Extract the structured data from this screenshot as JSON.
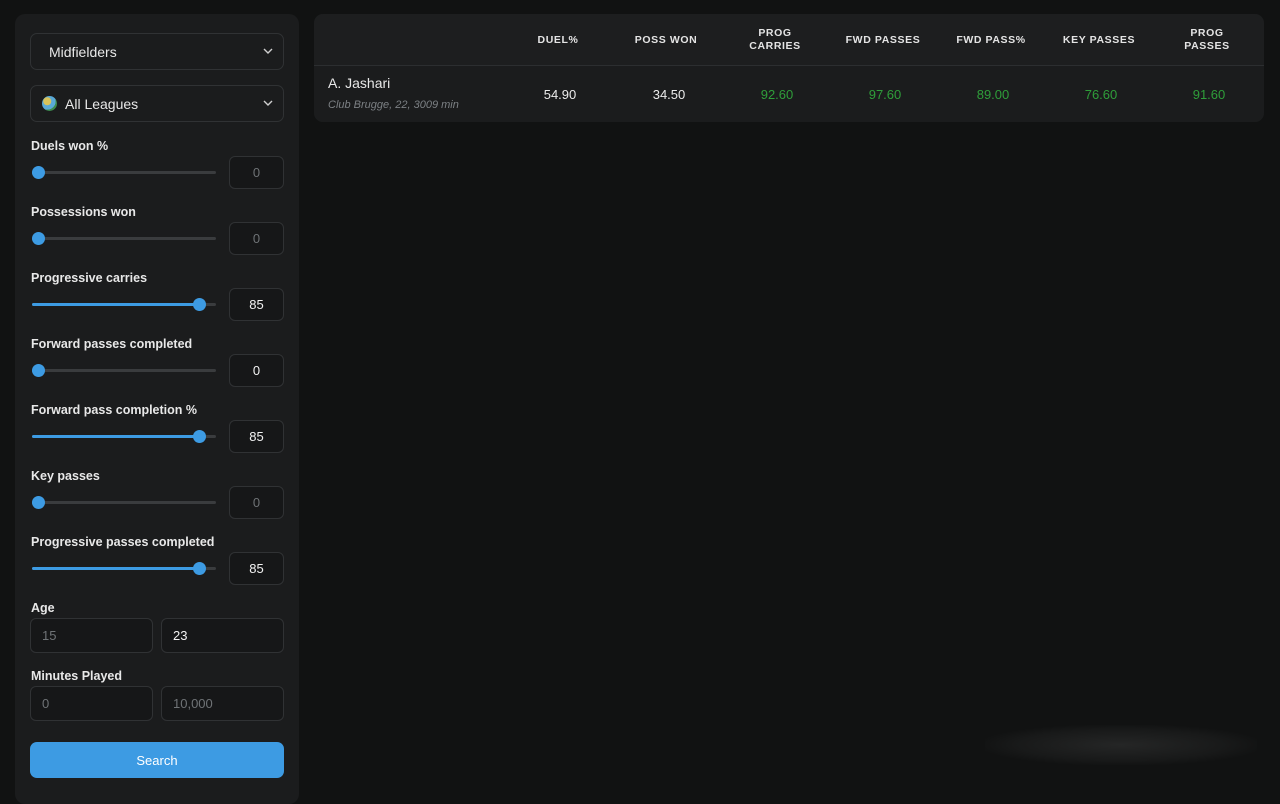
{
  "filters": {
    "position_select": "Midfielders",
    "league_select": "All Leagues",
    "sliders": [
      {
        "label": "Duels won %",
        "value": "0",
        "fraction": 0.0,
        "active": false
      },
      {
        "label": "Possessions won",
        "value": "0",
        "fraction": 0.0,
        "active": false
      },
      {
        "label": "Progressive carries",
        "value": "85",
        "fraction": 0.85,
        "active": true
      },
      {
        "label": "Forward passes completed",
        "value": "0",
        "fraction": 0.0,
        "active": true
      },
      {
        "label": "Forward pass completion %",
        "value": "85",
        "fraction": 0.85,
        "active": true
      },
      {
        "label": "Key passes",
        "value": "0",
        "fraction": 0.0,
        "active": false
      },
      {
        "label": "Progressive passes completed",
        "value": "85",
        "fraction": 0.85,
        "active": true
      }
    ],
    "age": {
      "label": "Age",
      "min": "15",
      "max": "23"
    },
    "minutes": {
      "label": "Minutes Played",
      "min": "0",
      "max": "10,000"
    },
    "search_label": "Search"
  },
  "table": {
    "columns": [
      "DUEL%",
      "POSS WON",
      "PROG CARRIES",
      "FWD PASSES",
      "FWD PASS%",
      "KEY PASSES",
      "PROG PASSES"
    ],
    "rows": [
      {
        "name": "A. Jashari",
        "meta": "Club Brugge, 22, 3009 min",
        "values": [
          "54.90",
          "34.50",
          "92.60",
          "97.60",
          "89.00",
          "76.60",
          "91.60"
        ],
        "highlight": [
          false,
          false,
          true,
          true,
          true,
          true,
          true
        ]
      }
    ]
  },
  "colors": {
    "accent": "#3d9be3",
    "good": "#2f9e3a"
  },
  "icons": {
    "dropdown": "chevron-down-icon",
    "league": "globe-icon"
  }
}
